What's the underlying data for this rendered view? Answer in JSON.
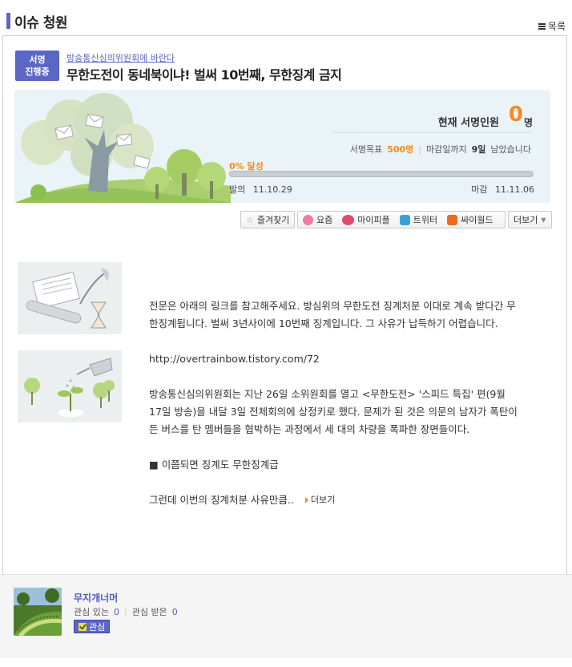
{
  "header": {
    "title": "이슈 청원",
    "list_label": "목록"
  },
  "petition": {
    "status_line1": "서명",
    "status_line2": "진행중",
    "category": "방송통신심의위원회에 바란다",
    "title": "무한도전이 동네북이냐! 벌써 10번째, 무한징계 금지"
  },
  "summary": {
    "count_label": "현재 서명인원",
    "count_value": "0",
    "count_unit": "명",
    "goal_label": "서명목표",
    "goal_value": "500명",
    "deadline_prefix": "마감일까지",
    "deadline_days": "9일",
    "deadline_suffix": "남았습니다",
    "achieve_label": "0% 달성",
    "progress_fraction": 0,
    "start_label": "발의",
    "start_date": "11.10.29",
    "end_label": "마감",
    "end_date": "11.11.06"
  },
  "actions": {
    "bookmark": "즐겨찾기",
    "yozm": "요즘",
    "mypeople": "마이피플",
    "twitter": "트위터",
    "cyworld": "싸이월드",
    "more": "더보기"
  },
  "content": {
    "para1": "전문은 아래의 링크를 참고해주세요. 방심위의 무한도전 징계처분 이대로 계속 받다간 무한징계됩니다. 벌써 3년사이에 10번째 징계입니다. 그 사유가 납득하기 어렵습니다.",
    "link": "http://overtrainbow.tistory.com/72",
    "para2": "방송통신심의위원회는 지난 26일 소위원회를 열고 <무한도전> '스피드 특집' 편(9월 17일 방송)을 내달 3일 전체회의에 상정키로 했다. 문제가 된 것은 의문의 남자가 폭탄이 든 버스를 탄 멤버들을 협박하는 과정에서 세 대의 차량을 폭파한 장면들이다.",
    "para3": "■ 이쯤되면 징계도 무한징계급",
    "para4": "그런데 이번의 징계처분 사유만큼..",
    "more_label": "더보기"
  },
  "author": {
    "name": "무지개너머",
    "interested_label": "관심 있는",
    "interested_count": "0",
    "received_label": "관심 받은",
    "received_count": "0",
    "follow_label": "관심"
  },
  "colors": {
    "accent": "#5b67c4",
    "orange": "#f58a1f",
    "summary_bg": "#eaf4f8"
  }
}
